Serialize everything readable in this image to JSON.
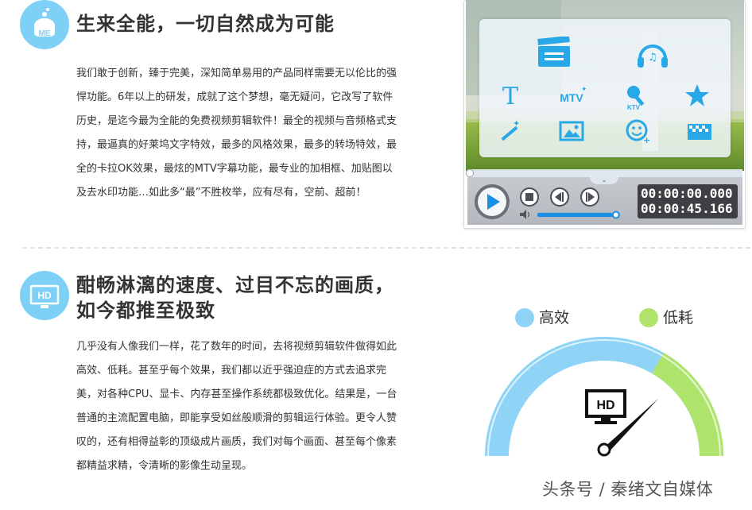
{
  "section1": {
    "badge_text": "ME",
    "title": "生来全能，一切自然成为可能",
    "lines": [
      "我们敢于创新，臻于完美，深知简单易用的产品同样需要无以伦比的强",
      "悍功能。6年以上的研发，成就了这个梦想，毫无疑问，它改写了软件",
      "历史，是迄今最为全能的免费视频剪辑软件！最全的视频与音频格式支",
      "持，最逼真的好莱坞文字特效，最多的风格效果，最多的转场特效，最",
      "全的卡拉OK效果，最炫的MTV字幕功能，最专业的加相框、加贴图以",
      "及去水印功能…如此多“最”不胜枚举，应有尽有，空前、超前！"
    ]
  },
  "player": {
    "panel_icons": [
      "clapperboard-icon",
      "headphones-icon",
      "text-icon",
      "mtv-icon",
      "ktv-icon",
      "star-icon",
      "magic-wand-icon",
      "picture-frame-icon",
      "sticker-icon",
      "mosaic-icon"
    ],
    "icon_labels": {
      "text": "T",
      "mtv": "MTV",
      "ktv": "KTV"
    },
    "current_time": "00:00:00.000",
    "total_time": "00:00:45.166",
    "progress": 0.0,
    "volume": 0.95,
    "colors": {
      "accent": "#1a8fe6",
      "icon": "#29a8e8"
    }
  },
  "section2": {
    "badge_text": "HD",
    "title_line1": "酣畅淋漓的速度、过目不忘的画质，",
    "title_line2": "如今都推至极致",
    "lines": [
      "几乎没有人像我们一样，花了数年的时间，去将视频剪辑软件做得如此",
      "高效、低耗。甚至乎每个效果，我们都以近乎强迫症的方式去追求完",
      "美，对各种CPU、显卡、内存甚至操作系统都极致优化。结果是，一台",
      "普通的主流配置电脑，即能享受如丝般顺滑的剪辑运行体验。更令人赞",
      "叹的，还有相得益彰的顶级成片画质，我们对每个画面、甚至每个像素",
      "都精益求精，令清晰的影像生动呈现。"
    ]
  },
  "gauge": {
    "legend": [
      {
        "label": "高效",
        "color": "#8fd4f7"
      },
      {
        "label": "低耗",
        "color": "#aee36c"
      }
    ],
    "hd_label": "HD",
    "colors": {
      "blue": "#8fd4f7",
      "green": "#aee36c"
    }
  },
  "watermark": "头条号 / 秦绪文自媒体"
}
